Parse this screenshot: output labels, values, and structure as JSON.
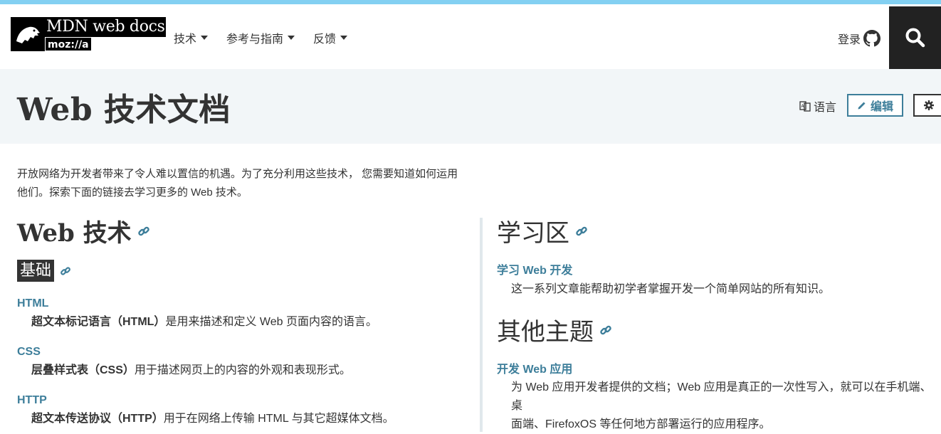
{
  "header": {
    "logo_title": "MDN web docs",
    "logo_sub": "moz://a",
    "nav": [
      "技术",
      "参考与指南",
      "反馈"
    ],
    "login_label": "登录"
  },
  "title_band": {
    "page_title": "Web 技术文档",
    "language_label": "语言",
    "edit_label": "编辑"
  },
  "intro_lines": [
    "开放网络为开发者带来了令人难以置信的机遇。为了充分利用这些技术， 您需要知道如何运用",
    "他们。探索下面的链接去学习更多的 Web 技术。"
  ],
  "left": {
    "heading": "Web 技术",
    "subheading": "基础",
    "entries": [
      {
        "title": "HTML",
        "term": "超文本标记语言（HTML）",
        "desc": "是用来描述和定义 Web 页面内容的语言。"
      },
      {
        "title": "CSS",
        "term": "层叠样式表（CSS）",
        "desc": "用于描述网页上的内容的外观和表现形式。"
      },
      {
        "title": "HTTP",
        "term": "超文本传送协议（HTTP）",
        "desc": "用于在网络上传输 HTML 与其它超媒体文档。"
      }
    ]
  },
  "right": {
    "heading1": "学习区",
    "entry1": {
      "title": "学习 Web 开发",
      "desc": "这一系列文章能帮助初学者掌握开发一个简单网站的所有知识。"
    },
    "heading2": "其他主题",
    "entry2": {
      "title": "开发 Web 应用",
      "desc_line1": "为 Web 应用开发者提供的文档；Web 应用是真正的一次性写入，就可以在手机端、桌",
      "desc_line2": "面端、FirefoxOS 等任何地方部署运行的应用程序。"
    }
  },
  "colors": {
    "link": "#3d7e9a",
    "band": "#f2f6f8",
    "dark": "#222222",
    "stripe": "#83d0f2"
  },
  "icons": [
    "dinosaur-logo-icon",
    "github-icon",
    "search-icon",
    "language-icon",
    "pencil-icon",
    "gear-icon",
    "link-icon"
  ]
}
